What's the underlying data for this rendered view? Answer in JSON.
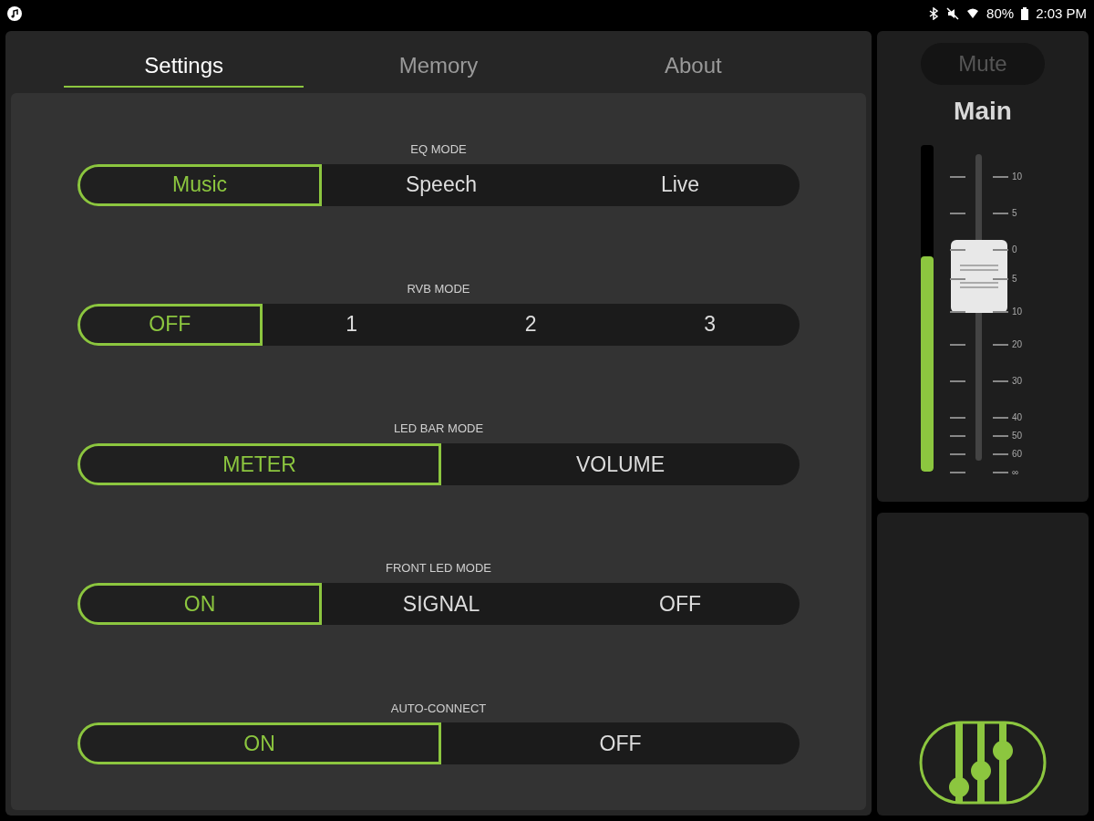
{
  "status_bar": {
    "battery": "80%",
    "time": "2:03 PM"
  },
  "tabs": [
    {
      "label": "Settings",
      "selected": true
    },
    {
      "label": "Memory",
      "selected": false
    },
    {
      "label": "About",
      "selected": false
    }
  ],
  "groups": [
    {
      "title": "EQ MODE",
      "options": [
        {
          "label": "Music",
          "selected": true
        },
        {
          "label": "Speech",
          "selected": false
        },
        {
          "label": "Live",
          "selected": false
        }
      ]
    },
    {
      "title": "RVB MODE",
      "options": [
        {
          "label": "OFF",
          "selected": true
        },
        {
          "label": "1",
          "selected": false
        },
        {
          "label": "2",
          "selected": false
        },
        {
          "label": "3",
          "selected": false
        }
      ]
    },
    {
      "title": "LED BAR MODE",
      "options": [
        {
          "label": "METER",
          "selected": true
        },
        {
          "label": "VOLUME",
          "selected": false
        }
      ]
    },
    {
      "title": "FRONT LED MODE",
      "options": [
        {
          "label": "ON",
          "selected": true
        },
        {
          "label": "SIGNAL",
          "selected": false
        },
        {
          "label": "OFF",
          "selected": false
        }
      ]
    },
    {
      "title": "AUTO-CONNECT",
      "options": [
        {
          "label": "ON",
          "selected": true
        },
        {
          "label": "OFF",
          "selected": false
        }
      ]
    }
  ],
  "channel": {
    "mute": {
      "label": "Mute",
      "on": false
    },
    "name": "Main",
    "meter": {
      "level": 0.66
    },
    "fader": {
      "level": 0.6
    },
    "scale": [
      "10",
      "5",
      "0",
      "5",
      "10",
      "20",
      "30",
      "40",
      "50",
      "60",
      "∞"
    ]
  }
}
